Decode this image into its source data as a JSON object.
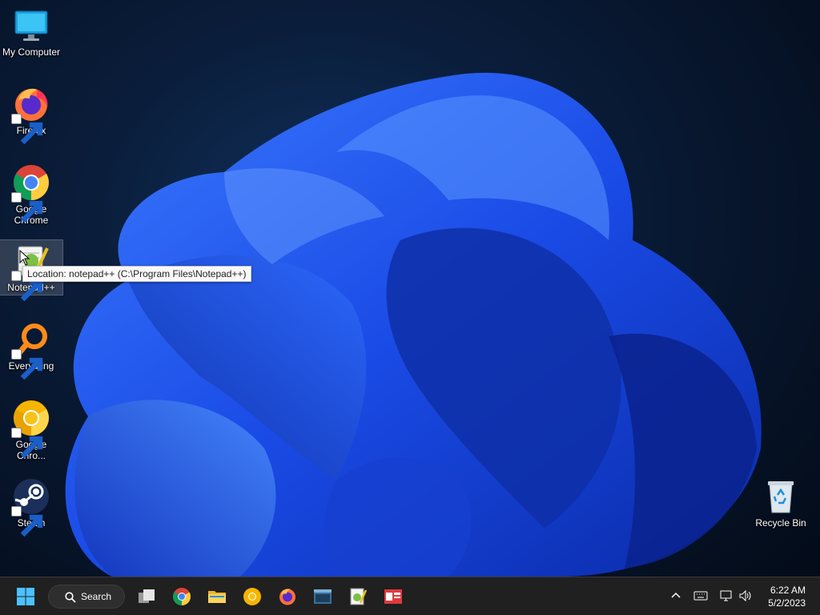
{
  "desktop": {
    "icons": [
      {
        "id": "my-computer",
        "label": "My Computer"
      },
      {
        "id": "firefox",
        "label": "Firefox"
      },
      {
        "id": "google-chrome",
        "label": "Google Chrome"
      },
      {
        "id": "notepadpp",
        "label": "Notepad++"
      },
      {
        "id": "everything",
        "label": "Everything"
      },
      {
        "id": "google-chrome-2",
        "label": "Google Chro..."
      },
      {
        "id": "steam",
        "label": "Steam"
      },
      {
        "id": "recycle-bin",
        "label": "Recycle Bin"
      }
    ],
    "tooltip": "Location: notepad++ (C:\\Program Files\\Notepad++)"
  },
  "taskbar": {
    "search_label": "Search",
    "time": "6:22 AM",
    "date": "5/2/2023"
  },
  "colors": {
    "taskbar_bg": "#202020",
    "accent": "#1e6cf0"
  }
}
